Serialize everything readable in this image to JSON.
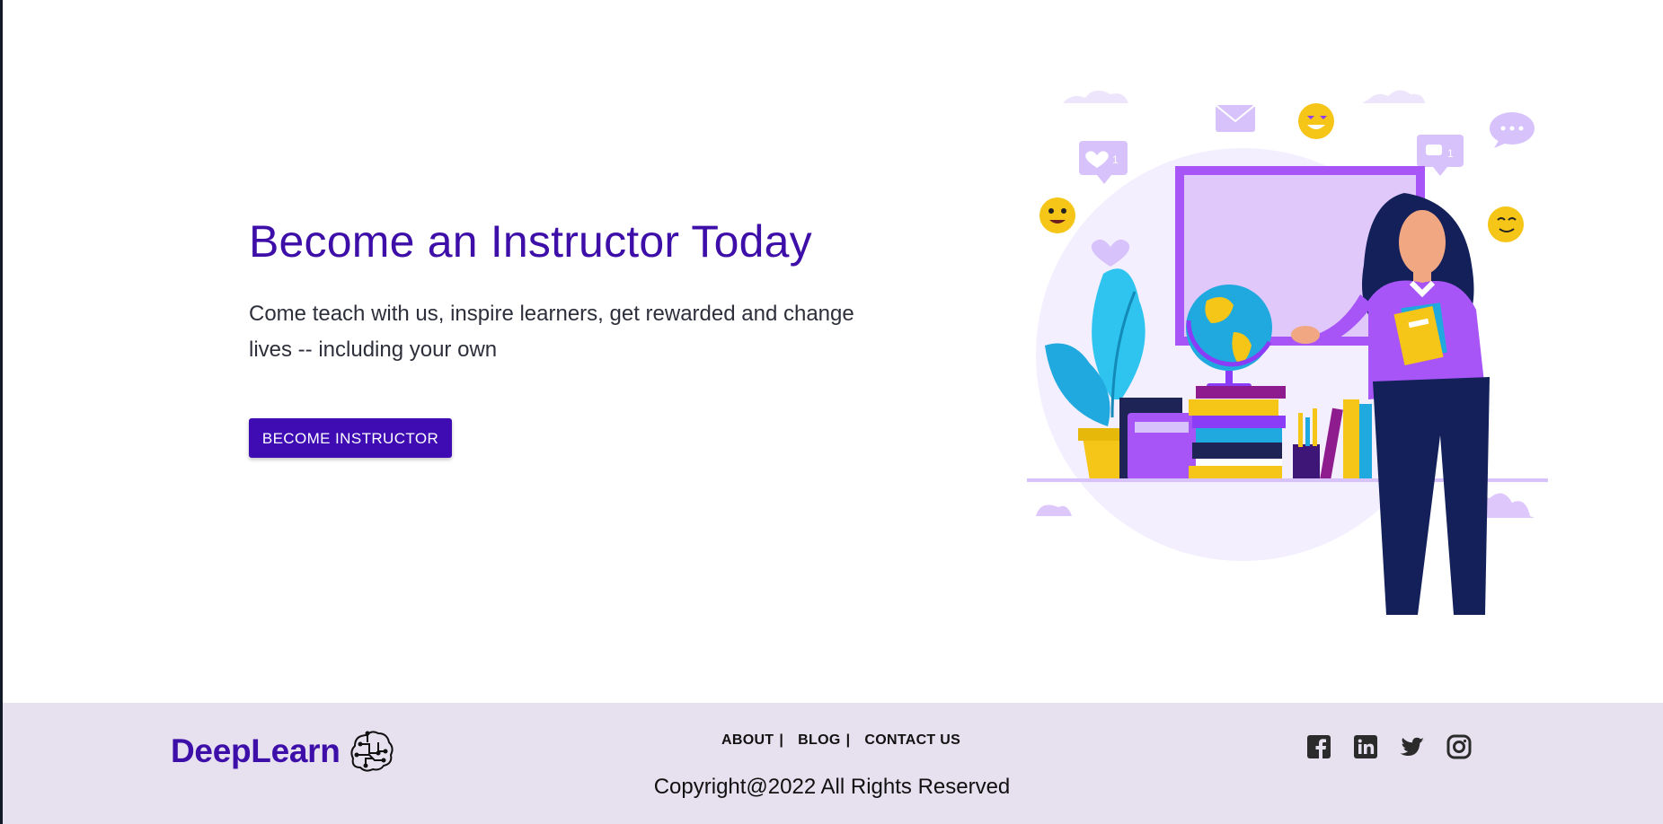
{
  "hero": {
    "title": "Become an Instructor Today",
    "subtitle": "Come teach with us, inspire learners, get rewarded and change lives -- including your own",
    "cta_label": "BECOME INSTRUCTOR"
  },
  "footer": {
    "logo_text": "DeepLearn",
    "nav": [
      {
        "label": "ABOUT",
        "separator": "|"
      },
      {
        "label": "BLOG",
        "separator": "|"
      },
      {
        "label": "CONTACT US"
      }
    ],
    "copyright": "Copyright@2022 All Rights Reserved",
    "social": [
      "facebook-icon",
      "linkedin-icon",
      "twitter-icon",
      "instagram-icon"
    ]
  },
  "colors": {
    "brand": "#3d0ea8",
    "footer_bg": "#e6e0ef",
    "accent_purple": "#a855f7",
    "accent_yellow": "#f5c518"
  }
}
